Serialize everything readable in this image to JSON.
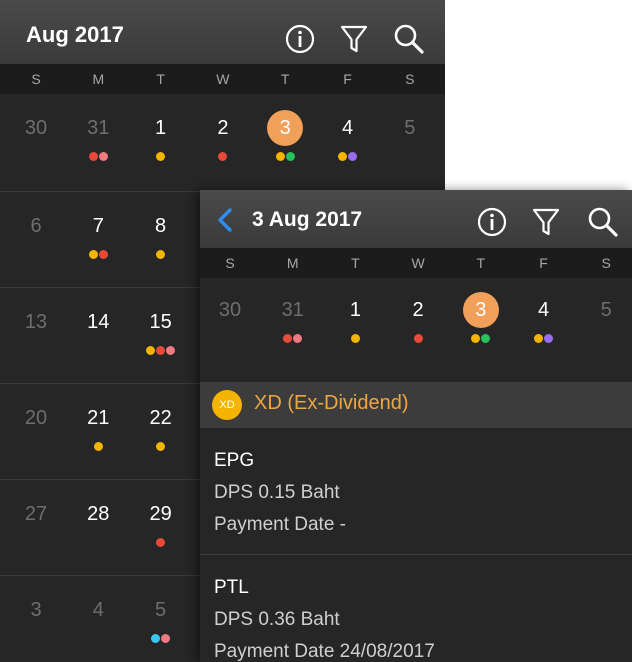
{
  "colors": {
    "red": "#e84a3a",
    "pink": "#f07a82",
    "yellow": "#f4b400",
    "green": "#27c35a",
    "purple": "#9a6cf0",
    "cyan": "#3ac6f0",
    "today": "#f0a058",
    "section_text": "#f0a640"
  },
  "month_view": {
    "title": "Aug 2017",
    "icons": [
      "info-icon",
      "filter-icon",
      "search-icon"
    ],
    "weekdays": [
      "S",
      "M",
      "T",
      "W",
      "T",
      "F",
      "S"
    ],
    "weeks": [
      [
        {
          "day": "30",
          "dim": true,
          "dots": []
        },
        {
          "day": "31",
          "dim": true,
          "dots": [
            "red",
            "pink"
          ]
        },
        {
          "day": "1",
          "dots": [
            "yellow"
          ]
        },
        {
          "day": "2",
          "dots": [
            "red"
          ]
        },
        {
          "day": "3",
          "today": true,
          "dots": [
            "yellow",
            "green"
          ]
        },
        {
          "day": "4",
          "dots": [
            "yellow",
            "purple"
          ]
        },
        {
          "day": "5",
          "dim": true,
          "dots": []
        }
      ],
      [
        {
          "day": "6",
          "dim": true,
          "dots": []
        },
        {
          "day": "7",
          "dots": [
            "yellow",
            "red"
          ]
        },
        {
          "day": "8",
          "dots": [
            "yellow"
          ]
        }
      ],
      [
        {
          "day": "13",
          "dim": true,
          "dots": []
        },
        {
          "day": "14",
          "dots": []
        },
        {
          "day": "15",
          "dots": [
            "yellow",
            "red",
            "pink"
          ]
        }
      ],
      [
        {
          "day": "20",
          "dim": true,
          "dots": []
        },
        {
          "day": "21",
          "dots": [
            "yellow"
          ]
        },
        {
          "day": "22",
          "dots": [
            "yellow"
          ]
        }
      ],
      [
        {
          "day": "27",
          "dim": true,
          "dots": []
        },
        {
          "day": "28",
          "dots": []
        },
        {
          "day": "29",
          "dots": [
            "red"
          ]
        }
      ],
      [
        {
          "day": "3",
          "dim": true,
          "dots": []
        },
        {
          "day": "4",
          "dim": true,
          "dots": []
        },
        {
          "day": "5",
          "dim": true,
          "dots": [
            "cyan",
            "pink"
          ]
        }
      ]
    ]
  },
  "day_view": {
    "title": "3 Aug 2017",
    "back_icon": "chevron-left-icon",
    "icons": [
      "info-icon",
      "filter-icon",
      "search-icon"
    ],
    "weekdays": [
      "S",
      "M",
      "T",
      "W",
      "T",
      "F",
      "S"
    ],
    "week": [
      {
        "day": "30",
        "dim": true,
        "dots": []
      },
      {
        "day": "31",
        "dim": true,
        "dots": [
          "red",
          "pink"
        ]
      },
      {
        "day": "1",
        "dots": [
          "yellow"
        ]
      },
      {
        "day": "2",
        "dots": [
          "red"
        ]
      },
      {
        "day": "3",
        "today": true,
        "dots": [
          "yellow",
          "green"
        ]
      },
      {
        "day": "4",
        "dots": [
          "yellow",
          "purple"
        ]
      },
      {
        "day": "5",
        "dim": true,
        "dots": []
      }
    ],
    "section": {
      "badge": "XD",
      "title": "XD (Ex-Dividend)"
    },
    "entries": [
      {
        "symbol": "EPG",
        "dps": "DPS 0.15 Baht",
        "payment": "Payment Date -"
      },
      {
        "symbol": "PTL",
        "dps": "DPS 0.36 Baht",
        "payment": "Payment Date 24/08/2017"
      }
    ]
  }
}
